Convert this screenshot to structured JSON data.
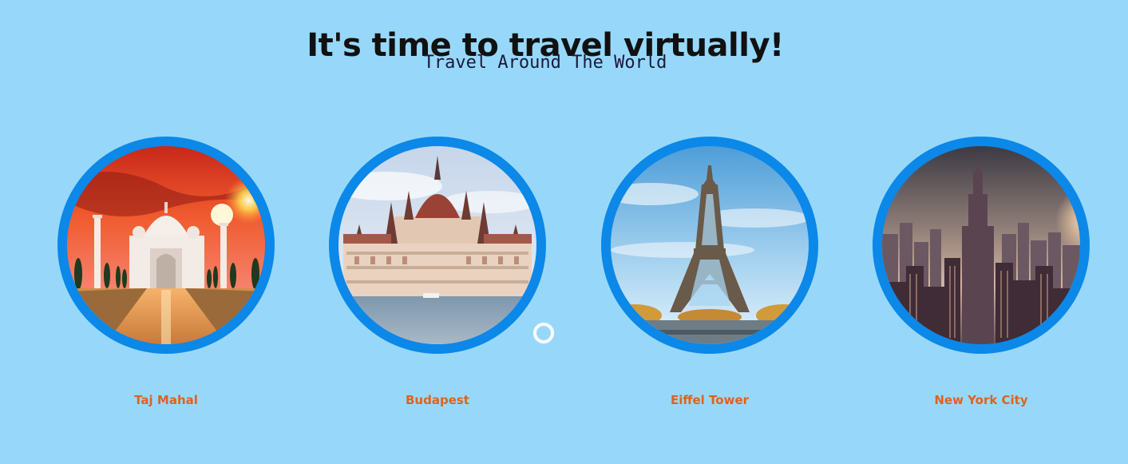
{
  "header": {
    "title": "It's time to travel virtually!",
    "subtitle": "Travel Around The World"
  },
  "destinations": [
    {
      "name": "Taj Mahal",
      "icon": "taj-mahal-photo"
    },
    {
      "name": "Budapest",
      "icon": "budapest-parliament-photo"
    },
    {
      "name": "Eiffel Tower",
      "icon": "eiffel-tower-photo"
    },
    {
      "name": "New York City",
      "icon": "new-york-skyline-photo"
    }
  ],
  "colors": {
    "background": "#97d8fa",
    "ring": "#0b88e8",
    "label": "#e0621c",
    "title": "#111111"
  }
}
